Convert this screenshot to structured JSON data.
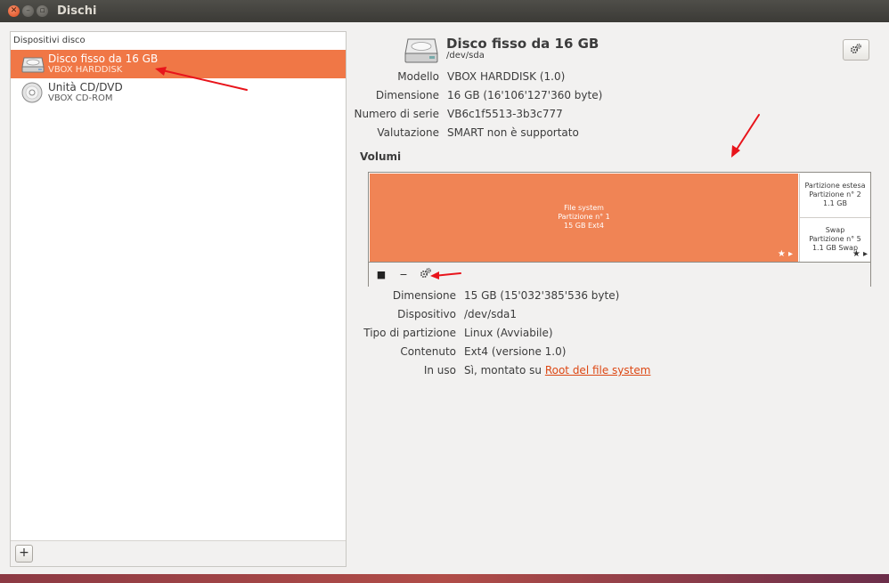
{
  "window": {
    "title": "Dischi"
  },
  "sidebar": {
    "header": "Dispositivi disco",
    "devices": [
      {
        "name": "Disco fisso da 16 GB",
        "sub": "VBOX HARDDISK",
        "selected": true,
        "icon": "harddisk-icon"
      },
      {
        "name": "Unità CD/DVD",
        "sub": "VBOX CD-ROM",
        "selected": false,
        "icon": "cdrom-icon"
      }
    ],
    "add_label": "+"
  },
  "disk": {
    "title": "Disco fisso da 16 GB",
    "device": "/dev/sda",
    "props": [
      {
        "label": "Modello",
        "value": "VBOX HARDDISK (1.0)"
      },
      {
        "label": "Dimensione",
        "value": "16 GB (16'106'127'360 byte)"
      },
      {
        "label": "Numero di serie",
        "value": "VB6c1f5513-3b3c777"
      },
      {
        "label": "Valutazione",
        "value": "SMART non è supportato"
      }
    ]
  },
  "volumes": {
    "heading": "Volumi",
    "main": {
      "line1": "File system",
      "line2": "Partizione n° 1",
      "line3": "15 GB Ext4",
      "marks": "★ ▸"
    },
    "extended": {
      "line1": "Partizione estesa",
      "line2": "Partizione n° 2",
      "line3": "1.1 GB"
    },
    "swap": {
      "line1": "Swap",
      "line2": "Partizione n° 5",
      "line3": "1.1 GB Swap",
      "marks": "★ ▸"
    },
    "toolbar": {
      "stop": "■",
      "minus": "−"
    }
  },
  "partition": {
    "props": [
      {
        "label": "Dimensione",
        "value": "15 GB (15'032'385'536 byte)"
      },
      {
        "label": "Dispositivo",
        "value": "/dev/sda1"
      },
      {
        "label": "Tipo di partizione",
        "value": "Linux (Avviabile)"
      },
      {
        "label": "Contenuto",
        "value": "Ext4 (versione 1.0)"
      }
    ],
    "in_use": {
      "label": "In uso",
      "prefix": "Sì, montato su ",
      "link": "Root del file system"
    }
  },
  "colors": {
    "accent": "#f07746",
    "partition_fill": "#f08455",
    "annotation_arrow": "#e8141b",
    "link": "#dd4814"
  }
}
